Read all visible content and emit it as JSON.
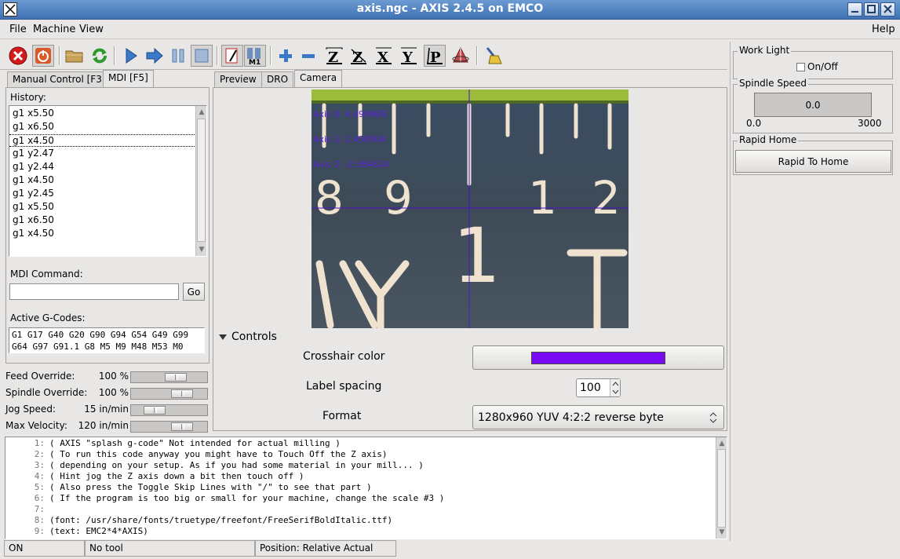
{
  "window": {
    "title": "axis.ngc - AXIS 2.4.5 on EMCO"
  },
  "menu": {
    "file": "File",
    "machine": "Machine",
    "view": "View",
    "help": "Help"
  },
  "toolbar": {
    "buttons": [
      "estop-icon",
      "power-icon",
      "open-folder-icon",
      "reload-icon",
      "run-icon",
      "step-icon",
      "pause-icon",
      "stop-icon",
      "skip-lines-icon",
      "optional-stop-icon",
      "zoom-in-icon",
      "zoom-out-icon",
      "view-z-icon",
      "view-z2-icon",
      "view-x-icon",
      "view-y-icon",
      "view-p-icon",
      "rotate-icon",
      "clear-plot-icon"
    ],
    "view_labels": {
      "z": "Z",
      "z2": "Z",
      "x": "X",
      "y": "Y",
      "p": "P",
      "mi": "M1"
    }
  },
  "left_tabs": {
    "manual": "Manual Control [F3]",
    "mdi": "MDI [F5]"
  },
  "mdi": {
    "history_label": "History:",
    "history": [
      "g1 x5.50",
      "g1 x6.50",
      "g1 x4.50",
      "g1 y2.47",
      "g1 y2.44",
      "g1 x4.50",
      "g1 y2.45",
      "g1 x5.50",
      "g1 x6.50",
      "g1 x4.50"
    ],
    "selected_index": 2,
    "command_label": "MDI Command:",
    "command_value": "",
    "go_label": "Go",
    "active_label": "Active G-Codes:",
    "active_codes_line1": "G1 G17 G40 G20 G90 G94 G54 G49 G99",
    "active_codes_line2": "G64 G97 G91.1 G8 M5 M9 M48 M53 M0"
  },
  "overrides": [
    {
      "label": "Feed Override:",
      "value": "100 %",
      "level": 0.64
    },
    {
      "label": "Spindle Override:",
      "value": "100 %",
      "level": 0.76
    },
    {
      "label": "Jog Speed:",
      "value": "15 in/min",
      "level": 0.24
    },
    {
      "label": "Max Velocity:",
      "value": "120 in/min",
      "level": 0.76
    }
  ],
  "view_tabs": {
    "preview": "Preview",
    "dro": "DRO",
    "camera": "Camera"
  },
  "camera": {
    "axis_labels": [
      "Axis 0: 4.499968",
      "Axis 1: 2.450004",
      "Axis 2: -2.384624"
    ],
    "controls_label": "Controls",
    "crosshair_label": "Crosshair color",
    "crosshair_color": "#7a0cf5",
    "spacing_label": "Label spacing",
    "spacing_value": "100",
    "format_label": "Format",
    "format_value": "1280x960 YUV 4:2:2 reverse byte"
  },
  "right": {
    "work_light_title": "Work Light",
    "work_light_checkbox": "On/Off",
    "spindle_title": "Spindle Speed",
    "spindle_value": "0.0",
    "spindle_min": "0.0",
    "spindle_max": "3000",
    "rapid_title": "Rapid Home",
    "rapid_button": "Rapid To Home"
  },
  "code": [
    {
      "n": "1:",
      "t": "( AXIS \"splash g-code\" Not intended for actual milling )"
    },
    {
      "n": "2:",
      "t": "( To run this code anyway you might have to Touch Off the Z axis)"
    },
    {
      "n": "3:",
      "t": "( depending on your setup. As if you had some material in your mill... )"
    },
    {
      "n": "4:",
      "t": "( Hint jog the Z axis down a bit then touch off )"
    },
    {
      "n": "5:",
      "t": "( Also press the Toggle Skip Lines with \"/\" to see that part )"
    },
    {
      "n": "6:",
      "t": "( If the program is too big or small for your machine, change the scale #3 )"
    },
    {
      "n": "7:",
      "t": ""
    },
    {
      "n": "8:",
      "t": "(font: /usr/share/fonts/truetype/freefont/FreeSerifBoldItalic.ttf)"
    },
    {
      "n": "9:",
      "t": "(text: EMC2*4*AXIS)"
    }
  ],
  "status": {
    "state": "ON",
    "tool": "No tool",
    "position": "Position: Relative Actual"
  }
}
